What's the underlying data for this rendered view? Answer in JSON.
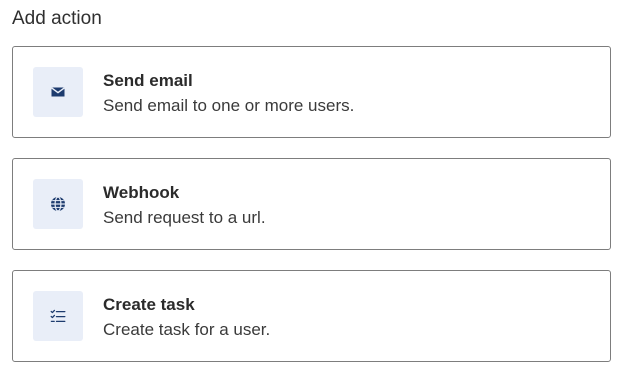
{
  "header": {
    "title": "Add action"
  },
  "actions": [
    {
      "title": "Send email",
      "description": "Send email to one or more users.",
      "icon": "envelope-icon"
    },
    {
      "title": "Webhook",
      "description": "Send request to a url.",
      "icon": "globe-icon"
    },
    {
      "title": "Create task",
      "description": "Create task for a user.",
      "icon": "checklist-icon"
    }
  ],
  "colors": {
    "icon_background": "#e9eef8",
    "icon_color": "#1d3b6e",
    "card_border": "#7d7d7d"
  }
}
